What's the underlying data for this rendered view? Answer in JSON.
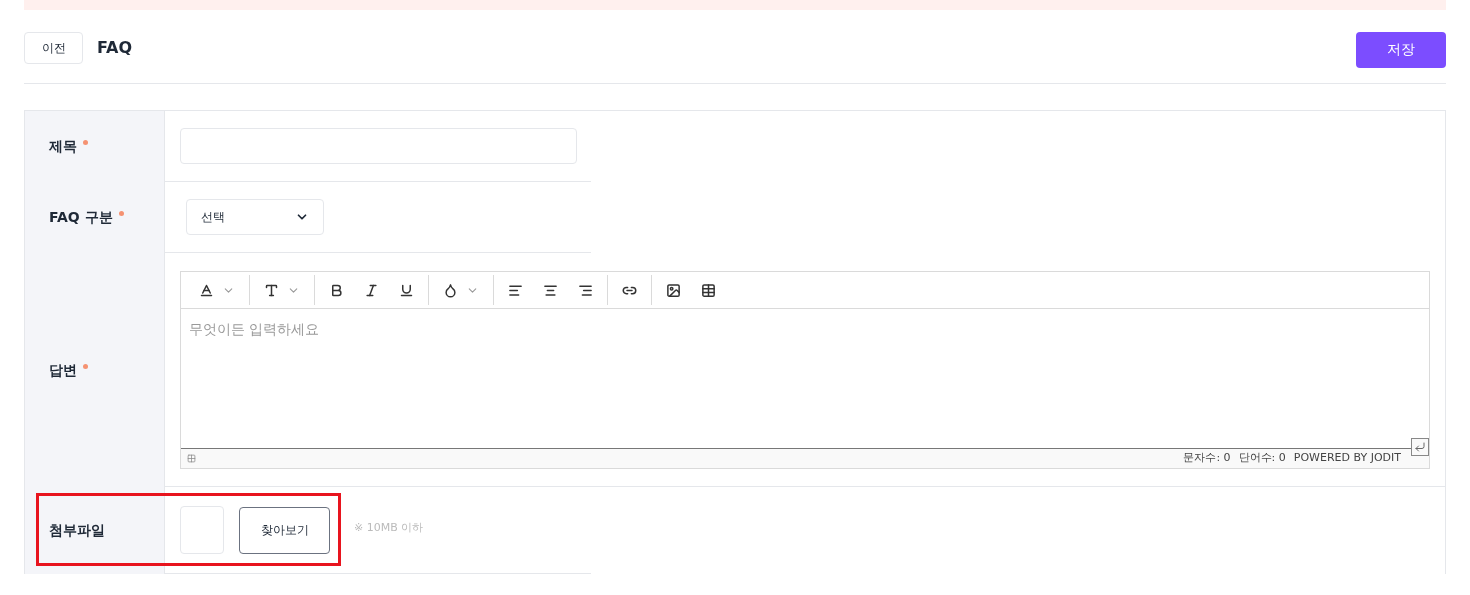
{
  "header": {
    "back_button": "이전",
    "title": "FAQ",
    "save_button": "저장"
  },
  "form": {
    "rows": [
      {
        "kind": "text",
        "label": "제목",
        "required": true,
        "highlighted": false,
        "value": ""
      },
      {
        "kind": "select",
        "label": "FAQ 구분",
        "required": true,
        "highlighted": false,
        "value": "선택"
      },
      {
        "kind": "editor",
        "label": "답변",
        "required": true,
        "highlighted": false,
        "placeholder": "무엇이든 입력하세요",
        "toolbar": [
          [
            {
              "kind": "font",
              "dropdown": true
            }
          ],
          [
            {
              "kind": "size",
              "dropdown": true
            }
          ],
          [
            {
              "kind": "bold",
              "dropdown": false
            },
            {
              "kind": "italic",
              "dropdown": false
            },
            {
              "kind": "underline",
              "dropdown": false
            }
          ],
          [
            {
              "kind": "color",
              "dropdown": true
            }
          ],
          [
            {
              "kind": "align-left",
              "dropdown": false
            },
            {
              "kind": "align-center",
              "dropdown": false
            },
            {
              "kind": "align-right",
              "dropdown": false
            }
          ],
          [
            {
              "kind": "link",
              "dropdown": false
            }
          ],
          [
            {
              "kind": "image",
              "dropdown": false
            },
            {
              "kind": "table",
              "dropdown": false
            }
          ]
        ],
        "status": [
          "문자수: 0",
          "단어수: 0",
          "POWERED BY JODIT"
        ]
      },
      {
        "kind": "file",
        "label": "첨부파일",
        "required": false,
        "highlighted": true,
        "button": "찾아보기",
        "note": "※ 10MB 이하"
      }
    ]
  }
}
